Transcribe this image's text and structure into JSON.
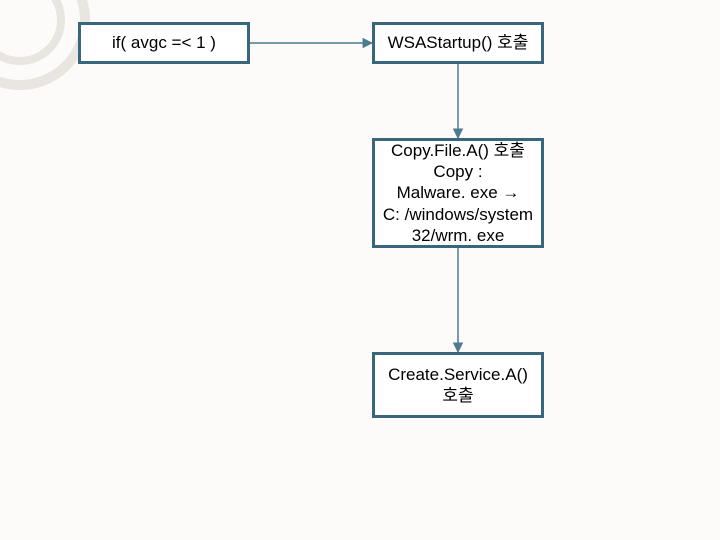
{
  "boxes": {
    "condition": {
      "text": "if( avgc =< 1 )"
    },
    "wsastartup": {
      "text": "WSAStartup() 호출"
    },
    "copyfile": {
      "text": "Copy.File.A() 호출\nCopy :\nMalware. exe  →\nC: /windows/system\n32/wrm. exe"
    },
    "createsvc": {
      "text": "Create.Service.A()\n호출"
    }
  },
  "connectors": {
    "stroke": "#4d7b90"
  }
}
